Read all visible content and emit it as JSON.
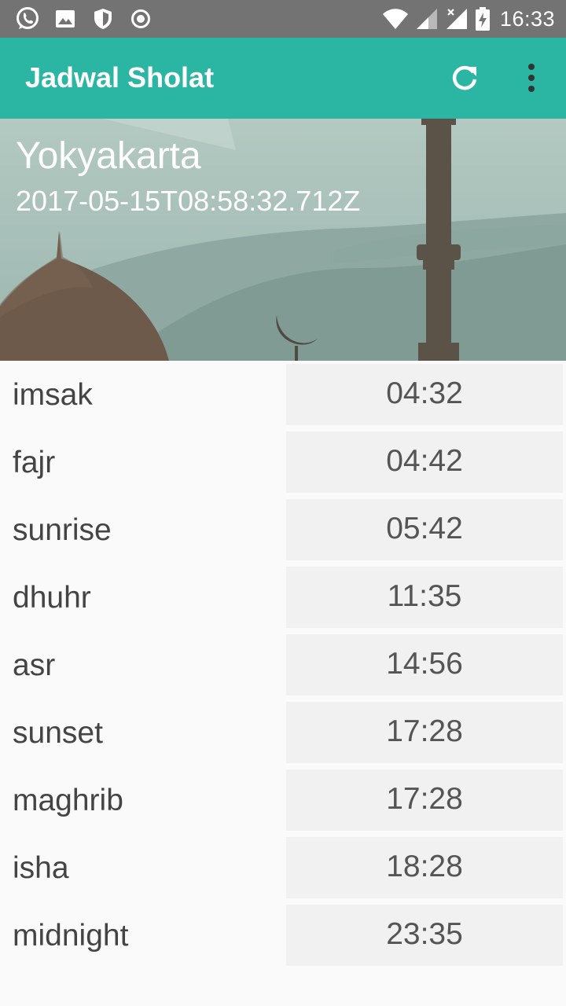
{
  "status_bar": {
    "time": "16:33",
    "left_icons": [
      "whatsapp-icon",
      "image-icon",
      "shield-icon",
      "record-icon"
    ],
    "right_icons": [
      "wifi-icon",
      "signal-icon",
      "no-sim-signal-icon",
      "battery-charging-icon"
    ]
  },
  "app_bar": {
    "title": "Jadwal Sholat",
    "actions": [
      "refresh-icon",
      "more-vert-icon"
    ]
  },
  "header": {
    "city": "Yokyakarta",
    "datetime": "2017-05-15T08:58:32.712Z"
  },
  "times": [
    {
      "name": "imsak",
      "time": "04:32"
    },
    {
      "name": "fajr",
      "time": "04:42"
    },
    {
      "name": "sunrise",
      "time": "05:42"
    },
    {
      "name": "dhuhr",
      "time": "11:35"
    },
    {
      "name": "asr",
      "time": "14:56"
    },
    {
      "name": "sunset",
      "time": "17:28"
    },
    {
      "name": "maghrib",
      "time": "17:28"
    },
    {
      "name": "isha",
      "time": "18:28"
    },
    {
      "name": "midnight",
      "time": "23:35"
    }
  ],
  "colors": {
    "status_bar": "#737373",
    "primary": "#2bb5a3",
    "background": "#fafafa",
    "time_cell": "#f1f1f1"
  }
}
